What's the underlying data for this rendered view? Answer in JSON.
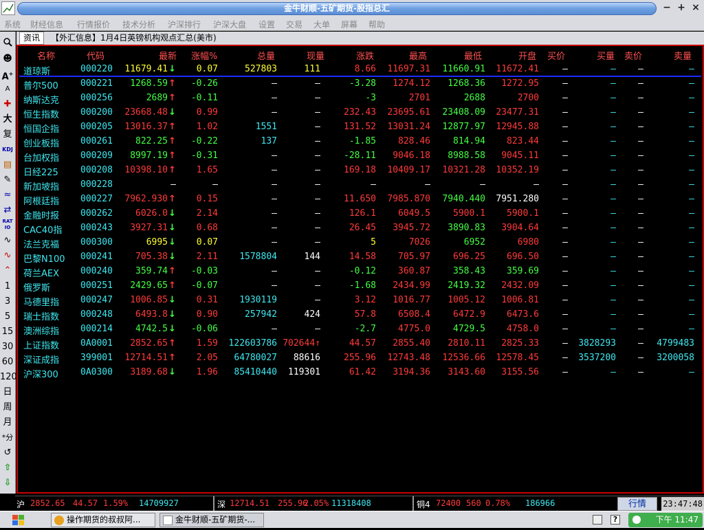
{
  "window": {
    "title": "金牛财顺-五矿期货-股指总汇"
  },
  "menu": [
    "系统",
    "财经信息",
    "行情报价",
    "技术分析",
    "沪深排行",
    "沪深大盘",
    "设置",
    "交易",
    "大单",
    "屏幕",
    "帮助"
  ],
  "toolbar": [
    "1",
    "3",
    "5",
    "15",
    "30",
    "60",
    "120",
    "日",
    "周",
    "月",
    "*分"
  ],
  "tab": {
    "label": "资讯",
    "news": "【外汇信息】1月4日英镑机构观点汇总(美市)"
  },
  "columns": [
    "名称",
    "代码",
    "最新",
    "涨幅%",
    "总量",
    "现量",
    "涨跌",
    "最高",
    "最低",
    "开盘",
    "买价",
    "买量",
    "卖价",
    "卖量"
  ],
  "rows": [
    {
      "name": "道琼斯",
      "code": "000220",
      "last": "11679.41",
      "arrow": "↓",
      "pct": "0.07",
      "vol": "527803",
      "cur": "111",
      "chg": "8.66",
      "high": "11697.31",
      "low": "11660.91",
      "open": "11672.41",
      "bid": "—",
      "bidv": "—",
      "ask": "—",
      "askv": "—",
      "c_last": "yl",
      "c_pct": "yl",
      "c_chg": "up",
      "c_high": "up",
      "c_low": "dn",
      "c_open": "up",
      "c_vol": "yl",
      "c_cur": "yl"
    },
    {
      "name": "普尔500",
      "code": "000221",
      "last": "1268.59",
      "arrow": "↑",
      "pct": "-0.26",
      "vol": "—",
      "cur": "—",
      "chg": "-3.28",
      "high": "1274.12",
      "low": "1268.36",
      "open": "1272.95",
      "bid": "—",
      "bidv": "—",
      "ask": "—",
      "askv": "—",
      "c_last": "dn",
      "c_pct": "dn",
      "c_chg": "dn",
      "c_high": "up",
      "c_low": "dn",
      "c_open": "up"
    },
    {
      "name": "纳斯达克",
      "code": "000256",
      "last": "2689",
      "arrow": "↑",
      "pct": "-0.11",
      "vol": "—",
      "cur": "—",
      "chg": "-3",
      "high": "2701",
      "low": "2688",
      "open": "2700",
      "bid": "—",
      "bidv": "—",
      "ask": "—",
      "askv": "—",
      "c_last": "dn",
      "c_pct": "dn",
      "c_chg": "dn",
      "c_high": "up",
      "c_low": "dn",
      "c_open": "up"
    },
    {
      "name": "恒生指数",
      "code": "000200",
      "last": "23668.48",
      "arrow": "↓",
      "pct": "0.99",
      "vol": "—",
      "cur": "—",
      "chg": "232.43",
      "high": "23695.61",
      "low": "23408.09",
      "open": "23477.31",
      "bid": "—",
      "bidv": "—",
      "ask": "—",
      "askv": "—",
      "c_last": "up",
      "c_pct": "up",
      "c_chg": "up",
      "c_high": "up",
      "c_low": "dn",
      "c_open": "up"
    },
    {
      "name": "恒国企指",
      "code": "000205",
      "last": "13016.37",
      "arrow": "↑",
      "pct": "1.02",
      "vol": "1551",
      "cur": "—",
      "chg": "131.52",
      "high": "13031.24",
      "low": "12877.97",
      "open": "12945.88",
      "bid": "—",
      "bidv": "—",
      "ask": "—",
      "askv": "—",
      "c_last": "up",
      "c_pct": "up",
      "c_chg": "up",
      "c_high": "up",
      "c_low": "dn",
      "c_open": "up",
      "c_vol": "cy"
    },
    {
      "name": "创业板指",
      "code": "000261",
      "last": "822.25",
      "arrow": "↑",
      "pct": "-0.22",
      "vol": "137",
      "cur": "—",
      "chg": "-1.85",
      "high": "828.46",
      "low": "814.94",
      "open": "823.44",
      "bid": "—",
      "bidv": "—",
      "ask": "—",
      "askv": "—",
      "c_last": "dn",
      "c_pct": "dn",
      "c_chg": "dn",
      "c_high": "up",
      "c_low": "dn",
      "c_open": "up",
      "c_vol": "cy"
    },
    {
      "name": "台加权指",
      "code": "000209",
      "last": "8997.19",
      "arrow": "↑",
      "pct": "-0.31",
      "vol": "—",
      "cur": "—",
      "chg": "-28.11",
      "high": "9046.18",
      "low": "8988.58",
      "open": "9045.11",
      "bid": "—",
      "bidv": "—",
      "ask": "—",
      "askv": "—",
      "c_last": "dn",
      "c_pct": "dn",
      "c_chg": "dn",
      "c_high": "up",
      "c_low": "dn",
      "c_open": "up"
    },
    {
      "name": "日经225",
      "code": "000208",
      "last": "10398.10",
      "arrow": "↑",
      "pct": "1.65",
      "vol": "—",
      "cur": "—",
      "chg": "169.18",
      "high": "10409.17",
      "low": "10321.28",
      "open": "10352.19",
      "bid": "—",
      "bidv": "—",
      "ask": "—",
      "askv": "—",
      "c_last": "up",
      "c_pct": "up",
      "c_chg": "up",
      "c_high": "up",
      "c_low": "up",
      "c_open": "up"
    },
    {
      "name": "新加坡指",
      "code": "000228",
      "last": "—",
      "arrow": "",
      "pct": "—",
      "vol": "—",
      "cur": "—",
      "chg": "—",
      "high": "—",
      "low": "—",
      "open": "—",
      "bid": "—",
      "bidv": "—",
      "ask": "—",
      "askv": "—",
      "c_last": "wh",
      "c_pct": "wh",
      "c_chg": "wh",
      "c_high": "wh",
      "c_low": "wh",
      "c_open": "wh"
    },
    {
      "name": "阿根廷指",
      "code": "000227",
      "last": "7962.930",
      "arrow": "↑",
      "pct": "0.15",
      "vol": "—",
      "cur": "—",
      "chg": "11.650",
      "high": "7985.870",
      "low": "7940.440",
      "open": "7951.280",
      "bid": "—",
      "bidv": "—",
      "ask": "—",
      "askv": "—",
      "c_last": "up",
      "c_pct": "up",
      "c_chg": "up",
      "c_high": "up",
      "c_low": "dn",
      "c_open": "wh"
    },
    {
      "name": "金融时报",
      "code": "000262",
      "last": "6026.0",
      "arrow": "↓",
      "pct": "2.14",
      "vol": "—",
      "cur": "—",
      "chg": "126.1",
      "high": "6049.5",
      "low": "5900.1",
      "open": "5900.1",
      "bid": "—",
      "bidv": "—",
      "ask": "—",
      "askv": "—",
      "c_last": "up",
      "c_pct": "up",
      "c_chg": "up",
      "c_high": "up",
      "c_low": "up",
      "c_open": "up"
    },
    {
      "name": "CAC40指",
      "code": "000243",
      "last": "3927.31",
      "arrow": "↓",
      "pct": "0.68",
      "vol": "—",
      "cur": "—",
      "chg": "26.45",
      "high": "3945.72",
      "low": "3890.83",
      "open": "3904.64",
      "bid": "—",
      "bidv": "—",
      "ask": "—",
      "askv": "—",
      "c_last": "up",
      "c_pct": "up",
      "c_chg": "up",
      "c_high": "up",
      "c_low": "dn",
      "c_open": "up"
    },
    {
      "name": "法兰克福",
      "code": "000300",
      "last": "6995",
      "arrow": "↓",
      "pct": "0.07",
      "vol": "—",
      "cur": "—",
      "chg": "5",
      "high": "7026",
      "low": "6952",
      "open": "6980",
      "bid": "—",
      "bidv": "—",
      "ask": "—",
      "askv": "—",
      "c_last": "yl",
      "c_pct": "yl",
      "c_chg": "yl",
      "c_high": "up",
      "c_low": "dn",
      "c_open": "up"
    },
    {
      "name": "巴黎N100",
      "code": "000241",
      "last": "705.38",
      "arrow": "↓",
      "pct": "2.11",
      "vol": "1578804",
      "cur": "144",
      "chg": "14.58",
      "high": "705.97",
      "low": "696.25",
      "open": "696.50",
      "bid": "—",
      "bidv": "—",
      "ask": "—",
      "askv": "—",
      "c_last": "up",
      "c_pct": "up",
      "c_chg": "up",
      "c_high": "up",
      "c_low": "up",
      "c_open": "up",
      "c_vol": "cy",
      "c_cur": "wh"
    },
    {
      "name": "荷兰AEX",
      "code": "000240",
      "last": "359.74",
      "arrow": "↑",
      "pct": "-0.03",
      "vol": "—",
      "cur": "—",
      "chg": "-0.12",
      "high": "360.87",
      "low": "358.43",
      "open": "359.69",
      "bid": "—",
      "bidv": "—",
      "ask": "—",
      "askv": "—",
      "c_last": "dn",
      "c_pct": "dn",
      "c_chg": "dn",
      "c_high": "up",
      "c_low": "dn",
      "c_open": "dn"
    },
    {
      "name": "俄罗斯",
      "code": "000251",
      "last": "2429.65",
      "arrow": "↑",
      "pct": "-0.07",
      "vol": "—",
      "cur": "—",
      "chg": "-1.68",
      "high": "2434.99",
      "low": "2419.32",
      "open": "2432.09",
      "bid": "—",
      "bidv": "—",
      "ask": "—",
      "askv": "—",
      "c_last": "dn",
      "c_pct": "dn",
      "c_chg": "dn",
      "c_high": "up",
      "c_low": "dn",
      "c_open": "up"
    },
    {
      "name": "马德里指",
      "code": "000247",
      "last": "1006.85",
      "arrow": "↓",
      "pct": "0.31",
      "vol": "1930119",
      "cur": "—",
      "chg": "3.12",
      "high": "1016.77",
      "low": "1005.12",
      "open": "1006.81",
      "bid": "—",
      "bidv": "—",
      "ask": "—",
      "askv": "—",
      "c_last": "up",
      "c_pct": "up",
      "c_chg": "up",
      "c_high": "up",
      "c_low": "up",
      "c_open": "up",
      "c_vol": "cy"
    },
    {
      "name": "瑞士指数",
      "code": "000248",
      "last": "6493.8",
      "arrow": "↓",
      "pct": "0.90",
      "vol": "257942",
      "cur": "424",
      "chg": "57.8",
      "high": "6508.4",
      "low": "6472.9",
      "open": "6473.6",
      "bid": "—",
      "bidv": "—",
      "ask": "—",
      "askv": "—",
      "c_last": "up",
      "c_pct": "up",
      "c_chg": "up",
      "c_high": "up",
      "c_low": "up",
      "c_open": "up",
      "c_vol": "cy",
      "c_cur": "wh"
    },
    {
      "name": "澳洲综指",
      "code": "000214",
      "last": "4742.5",
      "arrow": "↓",
      "pct": "-0.06",
      "vol": "—",
      "cur": "—",
      "chg": "-2.7",
      "high": "4775.0",
      "low": "4729.5",
      "open": "4758.0",
      "bid": "—",
      "bidv": "—",
      "ask": "—",
      "askv": "—",
      "c_last": "dn",
      "c_pct": "dn",
      "c_chg": "dn",
      "c_high": "up",
      "c_low": "dn",
      "c_open": "up"
    },
    {
      "name": "上证指数",
      "code": "0A0001",
      "last": "2852.65",
      "arrow": "↑",
      "pct": "1.59",
      "vol": "122603786",
      "cur": "702644↑",
      "chg": "44.57",
      "high": "2855.40",
      "low": "2810.11",
      "open": "2825.33",
      "bid": "—",
      "bidv": "3828293",
      "ask": "—",
      "askv": "4799483",
      "c_last": "up",
      "c_pct": "up",
      "c_chg": "up",
      "c_high": "up",
      "c_low": "up",
      "c_open": "up",
      "c_vol": "cy",
      "c_cur": "up"
    },
    {
      "name": "深证成指",
      "code": "399001",
      "last": "12714.51",
      "arrow": "↑",
      "pct": "2.05",
      "vol": "64780027",
      "cur": "88616",
      "chg": "255.96",
      "high": "12743.48",
      "low": "12536.66",
      "open": "12578.45",
      "bid": "—",
      "bidv": "3537200",
      "ask": "—",
      "askv": "3200058",
      "c_last": "up",
      "c_pct": "up",
      "c_chg": "up",
      "c_high": "up",
      "c_low": "up",
      "c_open": "up",
      "c_vol": "cy",
      "c_cur": "wh"
    },
    {
      "name": "沪深300",
      "code": "0A0300",
      "last": "3189.68",
      "arrow": "↓",
      "pct": "1.96",
      "vol": "85410440",
      "cur": "119301",
      "chg": "61.42",
      "high": "3194.36",
      "low": "3143.60",
      "open": "3155.56",
      "bid": "—",
      "bidv": "—",
      "ask": "—",
      "askv": "—",
      "c_last": "up",
      "c_pct": "up",
      "c_chg": "up",
      "c_high": "up",
      "c_low": "up",
      "c_open": "up",
      "c_vol": "cy",
      "c_cur": "wh"
    }
  ],
  "status": {
    "sh": {
      "label": "沪",
      "price": "2852.65",
      "chg": "44.57",
      "pct": "1.59%",
      "vol": "14709927"
    },
    "sz": {
      "label": "深",
      "price": "12714.51",
      "chg": "255.96",
      "pct": "2.05%",
      "vol": "11318408"
    },
    "cu": {
      "label": "铜4",
      "price": "72400",
      "chg": "560",
      "pct": "0.78%",
      "vol": "186966"
    },
    "quote_btn": "行情",
    "clock": "23:47:48"
  },
  "taskbar": {
    "tasks": [
      "操作期货的叔叔阿...",
      "金牛财顺-五矿期货-..."
    ],
    "time": "下午 11:47"
  }
}
